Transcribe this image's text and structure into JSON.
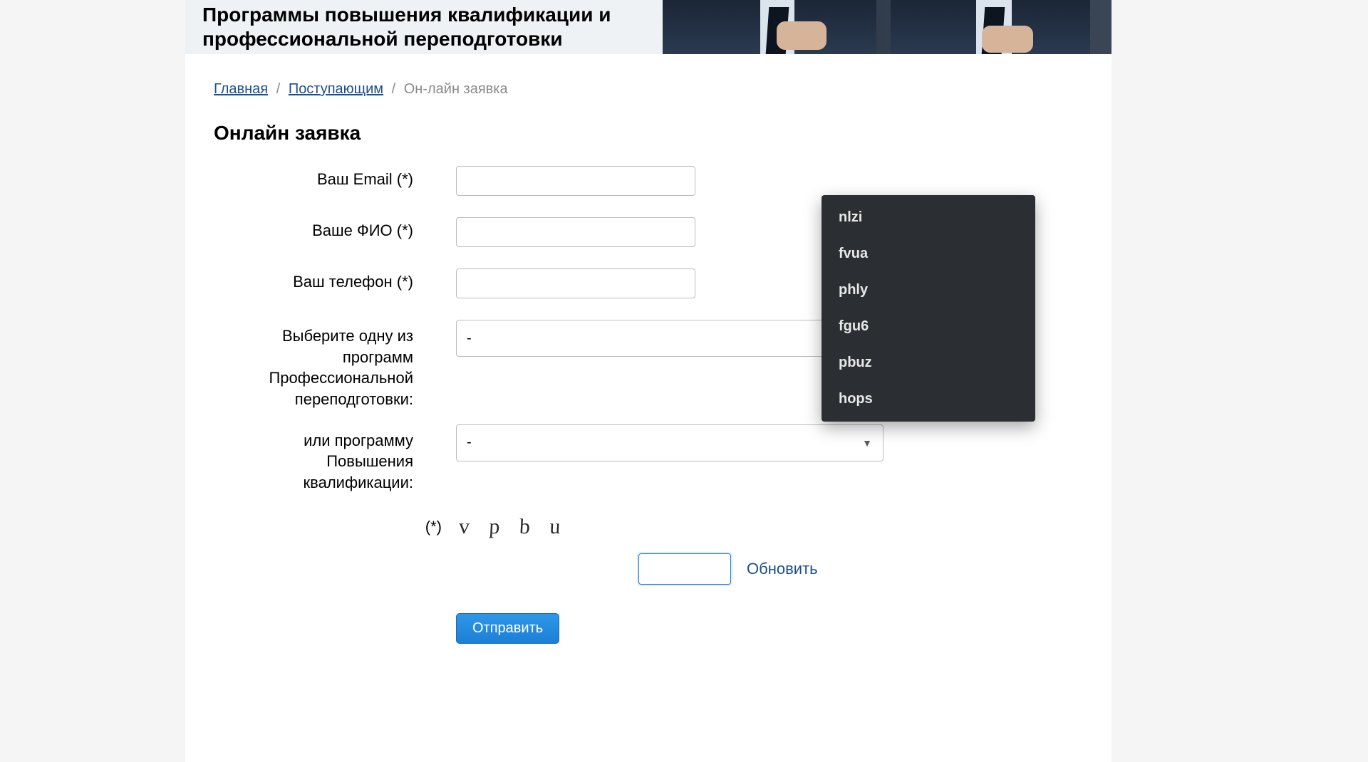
{
  "banner": {
    "title": "Программы повышения квалификации и профессиональной переподготовки"
  },
  "breadcrumb": {
    "home": "Главная",
    "applicants": "Поступающим",
    "current": "Он-лайн заявка"
  },
  "page_title": "Онлайн заявка",
  "form": {
    "email_label": "Ваш Email (*)",
    "fio_label": "Ваше ФИО (*)",
    "phone_label": "Ваш телефон (*)",
    "program1_label": "Выберите одну из программ Профессиональной переподготовки:",
    "program2_label": "или программу Повышения квалификации:",
    "program1_value": "-",
    "program2_value": "-",
    "captcha_label": "(*)",
    "captcha_image_text": "v p b u",
    "refresh_label": "Обновить",
    "submit_label": "Отправить"
  },
  "autocomplete": {
    "items": [
      "nlzi",
      "fvua",
      "phly",
      "fgu6",
      "pbuz",
      "hops"
    ]
  }
}
